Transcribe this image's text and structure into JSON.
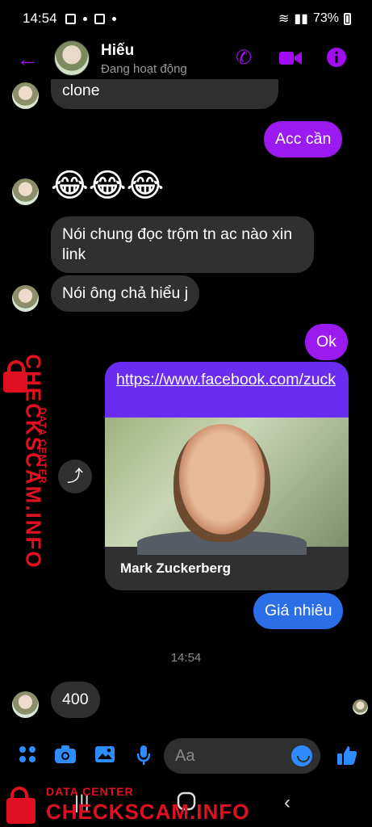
{
  "status_bar": {
    "time": "14:54",
    "battery": "73%"
  },
  "header": {
    "name": "Hiếu",
    "status": "Đang hoạt động"
  },
  "messages": {
    "m1": "clone",
    "m2": "Acc cần",
    "m3_emoji": "😂😂😂",
    "m4": "Nói chung đọc trộm tn ac nào xin link",
    "m5": "Nói ông chả hiểu j",
    "m6": "Ok",
    "link_url": "https://www.facebook.com/zuck",
    "link_title": "Mark Zuckerberg",
    "m7": "Giá nhiêu",
    "timestamp": "14:54",
    "m8": "400"
  },
  "composer": {
    "placeholder": "Aa"
  },
  "watermark": {
    "small": "DATA CENTER",
    "big": "CHECKSCAM.INFO"
  },
  "colors": {
    "accent": "#a20cf2",
    "my_bubble": "#9a1af0",
    "blue_bubble": "#2a6fe8",
    "their_bubble": "#303030",
    "composer_icons": "#2d8cff"
  }
}
